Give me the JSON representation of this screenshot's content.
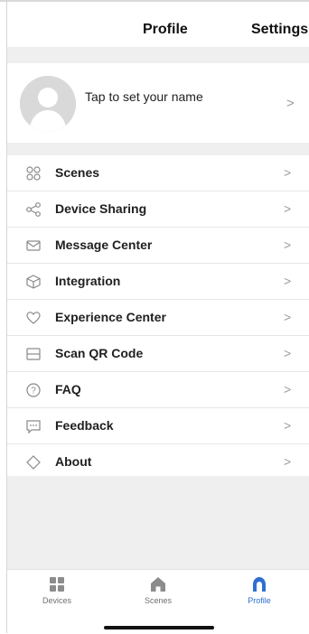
{
  "header": {
    "title": "Profile",
    "settings": "Settings"
  },
  "profile": {
    "prompt": "Tap to set your name",
    "chevron": ">"
  },
  "menu": {
    "chevron": ">",
    "items": [
      {
        "label": "Scenes",
        "icon": "scenes-icon"
      },
      {
        "label": "Device Sharing",
        "icon": "share-icon"
      },
      {
        "label": "Message Center",
        "icon": "envelope-icon"
      },
      {
        "label": "Integration",
        "icon": "cube-icon"
      },
      {
        "label": "Experience Center",
        "icon": "heart-icon"
      },
      {
        "label": "Scan QR Code",
        "icon": "scan-icon"
      },
      {
        "label": "FAQ",
        "icon": "question-icon"
      },
      {
        "label": "Feedback",
        "icon": "feedback-icon"
      },
      {
        "label": "About",
        "icon": "diamond-icon"
      }
    ]
  },
  "tabbar": {
    "tabs": [
      {
        "label": "Devices",
        "icon": "grid-icon",
        "active": false
      },
      {
        "label": "Scenes",
        "icon": "home-icon",
        "active": false
      },
      {
        "label": "Profile",
        "icon": "profile-icon",
        "active": true
      }
    ]
  },
  "colors": {
    "accent": "#2f6fd0",
    "background": "#efefef",
    "text": "#202020"
  }
}
